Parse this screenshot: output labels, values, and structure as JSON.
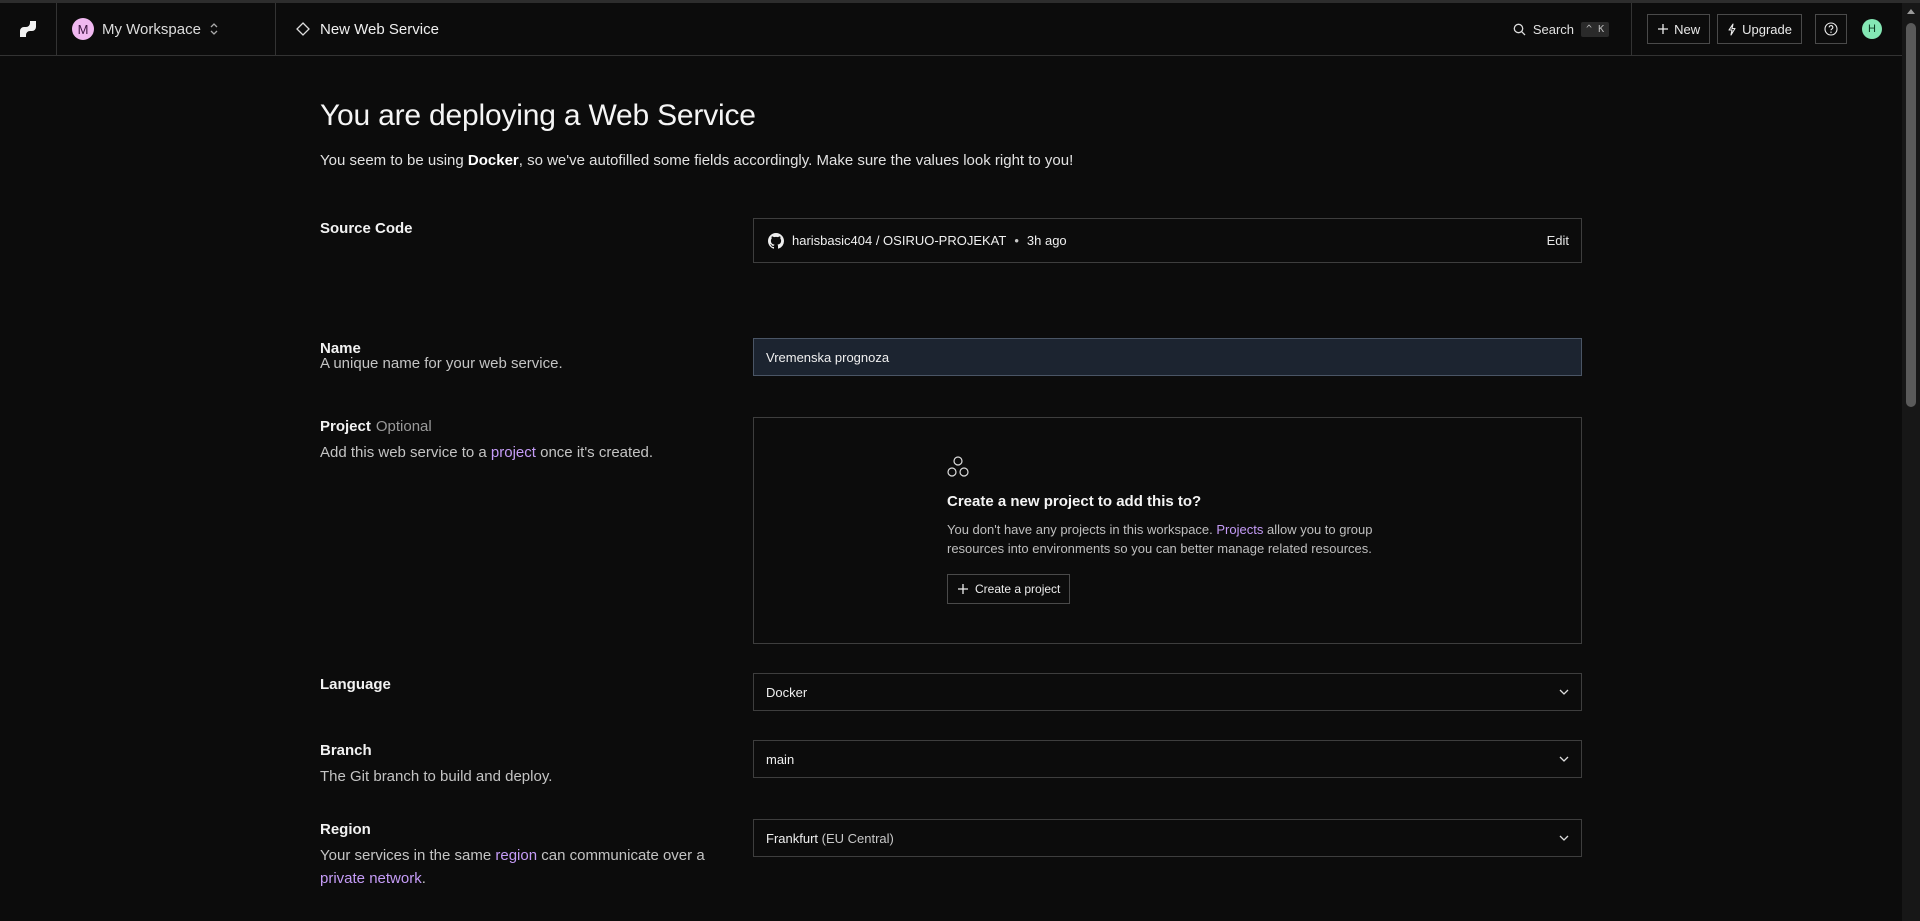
{
  "topbar": {
    "workspace_initial": "M",
    "workspace_name": "My Workspace",
    "page_title": "New Web Service",
    "search_label": "Search",
    "search_shortcut": "^ K",
    "new_label": "New",
    "upgrade_label": "Upgrade",
    "help_icon": "question-circle-icon",
    "user_initial": "H"
  },
  "header": {
    "title": "You are deploying a Web Service",
    "subtitle_prefix": "You seem to be using ",
    "subtitle_bold": "Docker",
    "subtitle_suffix": ", so we've autofilled some fields accordingly. Make sure the values look right to you!"
  },
  "source_code": {
    "label": "Source Code",
    "repo": "harisbasic404 / OSIRUO-PROJEKAT",
    "separator": "•",
    "time": "3h ago",
    "edit_label": "Edit",
    "icon": "github-icon"
  },
  "name": {
    "label": "Name",
    "description": "A unique name for your web service.",
    "value": "Vremenska prognoza"
  },
  "project": {
    "label": "Project",
    "optional": "Optional",
    "desc_prefix": "Add this web service to a ",
    "desc_link": "project",
    "desc_suffix": " once it's created.",
    "card_title": "Create a new project to add this to?",
    "card_text_prefix": "You don't have any projects in this workspace. ",
    "card_text_link": "Projects",
    "card_text_suffix": " allow you to group resources into environments so you can better manage related resources.",
    "create_label": "Create a project"
  },
  "language": {
    "label": "Language",
    "value": "Docker"
  },
  "branch": {
    "label": "Branch",
    "description": "The Git branch to build and deploy.",
    "value": "main"
  },
  "region": {
    "label": "Region",
    "desc_prefix": "Your services in the same ",
    "desc_link1": "region",
    "desc_mid": " can communicate over a ",
    "desc_link2": "private network",
    "desc_suffix": ".",
    "value_main": "Frankfurt",
    "value_sub": "(EU Central)"
  },
  "colors": {
    "background": "#0c0c0c",
    "link": "#c59cf7",
    "workspace_avatar": "#f0b8f0",
    "user_avatar": "#84e7b4"
  }
}
